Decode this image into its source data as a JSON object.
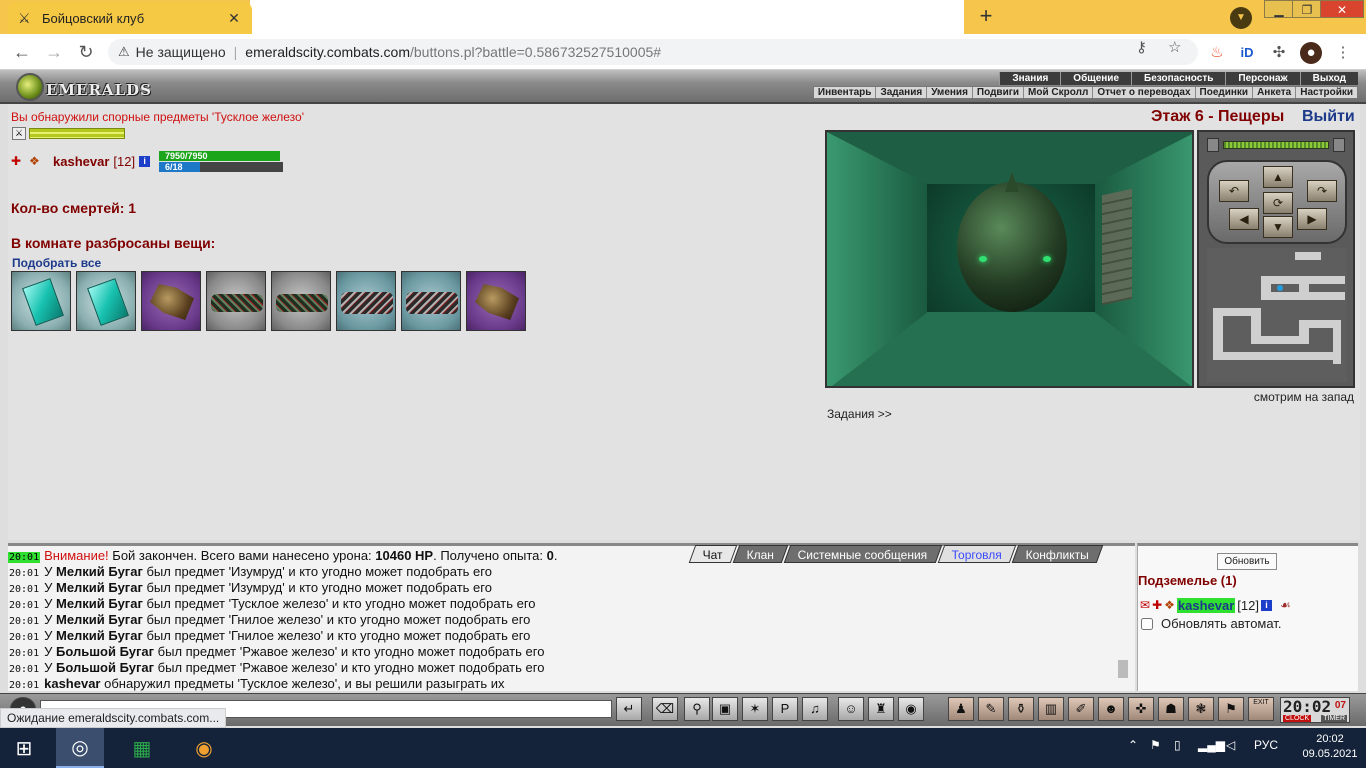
{
  "browser": {
    "tab_title": "Бойцовский клуб",
    "tab_close": "✕",
    "new_tab": "+",
    "security_label": "Не защищено",
    "url_host": "emeraldscity.combats.com",
    "url_path": "/buttons.pl?battle=0.586732527510005#",
    "status_text": "Ожидание emeraldscity.combats.com..."
  },
  "header": {
    "logo_text": "EMERALDS",
    "menu_top": [
      "Знания",
      "Общение",
      "Безопасность",
      "Персонаж",
      "Выход"
    ],
    "menu_bottom": [
      "Инвентарь",
      "Задания",
      "Умения",
      "Подвиги",
      "Мой Скролл",
      "Отчет о переводах",
      "Поединки",
      "Анкета",
      "Настройки"
    ]
  },
  "game": {
    "found_message": "Вы обнаружили спорные предметы 'Тусклое железо'",
    "player": {
      "name": "kashevar",
      "level": "[12]",
      "hp_text": "7950/7950",
      "mp_text": "6/18",
      "hp_fraction": 1.0,
      "mp_fraction": 0.333
    },
    "deaths_label": "Кол-во смертей: 1",
    "scattered_label": "В комнате разбросаны вещи:",
    "pick_all_label": "Подобрать все",
    "items": [
      "emerald",
      "emerald",
      "purple",
      "grey",
      "grey",
      "teal",
      "teal",
      "purple"
    ],
    "floor_title": "Этаж 6 - Пещеры",
    "exit_label": "Выйти",
    "looking_label": "смотрим на запад",
    "tasks_label": "Задания >>"
  },
  "chat": {
    "tabs": [
      {
        "label": "Чат",
        "state": "active"
      },
      {
        "label": "Клан",
        "state": "normal"
      },
      {
        "label": "Системные сообщения",
        "state": "normal"
      },
      {
        "label": "Торговля",
        "state": "blue"
      },
      {
        "label": "Конфликты",
        "state": "normal"
      }
    ],
    "lines": [
      {
        "time": "20:01",
        "highlight": true,
        "parts": [
          {
            "t": "Внимание!",
            "s": "red"
          },
          {
            "t": " Бой закончен. Всего вами нанесено урона: ",
            "s": ""
          },
          {
            "t": "10460 HP",
            "s": "b"
          },
          {
            "t": ". Получено опыта: ",
            "s": ""
          },
          {
            "t": "0",
            "s": "b"
          },
          {
            "t": ".",
            "s": ""
          }
        ]
      },
      {
        "time": "20:01",
        "highlight": false,
        "parts": [
          {
            "t": "У ",
            "s": ""
          },
          {
            "t": "Мелкий Бугаг",
            "s": "b"
          },
          {
            "t": " был предмет 'Изумруд' и кто угодно может подобрать его",
            "s": ""
          }
        ]
      },
      {
        "time": "20:01",
        "highlight": false,
        "parts": [
          {
            "t": "У ",
            "s": ""
          },
          {
            "t": "Мелкий Бугаг",
            "s": "b"
          },
          {
            "t": " был предмет 'Изумруд' и кто угодно может подобрать его",
            "s": ""
          }
        ]
      },
      {
        "time": "20:01",
        "highlight": false,
        "parts": [
          {
            "t": "У ",
            "s": ""
          },
          {
            "t": "Мелкий Бугаг",
            "s": "b"
          },
          {
            "t": " был предмет 'Тусклое железо' и кто угодно может подобрать его",
            "s": ""
          }
        ]
      },
      {
        "time": "20:01",
        "highlight": false,
        "parts": [
          {
            "t": "У ",
            "s": ""
          },
          {
            "t": "Мелкий Бугаг",
            "s": "b"
          },
          {
            "t": " был предмет 'Гнилое железо' и кто угодно может подобрать его",
            "s": ""
          }
        ]
      },
      {
        "time": "20:01",
        "highlight": false,
        "parts": [
          {
            "t": "У ",
            "s": ""
          },
          {
            "t": "Мелкий Бугаг",
            "s": "b"
          },
          {
            "t": " был предмет 'Гнилое железо' и кто угодно может подобрать его",
            "s": ""
          }
        ]
      },
      {
        "time": "20:01",
        "highlight": false,
        "parts": [
          {
            "t": "У ",
            "s": ""
          },
          {
            "t": "Большой Бугаг",
            "s": "b"
          },
          {
            "t": " был предмет 'Ржавое железо' и кто угодно может подобрать его",
            "s": ""
          }
        ]
      },
      {
        "time": "20:01",
        "highlight": false,
        "parts": [
          {
            "t": "У ",
            "s": ""
          },
          {
            "t": "Большой Бугаг",
            "s": "b"
          },
          {
            "t": " был предмет 'Ржавое железо' и кто угодно может подобрать его",
            "s": ""
          }
        ]
      },
      {
        "time": "20:01",
        "highlight": false,
        "parts": [
          {
            "t": "kashevar",
            "s": "b"
          },
          {
            "t": " обнаружил предметы 'Тусклое железо', и вы решили разыграть их",
            "s": ""
          }
        ]
      }
    ]
  },
  "online": {
    "refresh_label": "Обновить",
    "room_label": "Подземелье (1)",
    "user_name": "kashevar",
    "user_level": "[12]",
    "auto_refresh_label": "Обновлять автомат."
  },
  "toolbar": {
    "clock_time": "20:02",
    "clock_seconds": "07",
    "clock_label": "CLOCK",
    "timer_label": "TIMER",
    "exit_label": "EXIT"
  },
  "taskbar": {
    "lang": "РУС",
    "time": "20:02",
    "date": "09.05.2021"
  },
  "colors": {
    "tabstrip": "#f5c64b",
    "accent_red": "#800000",
    "link_blue": "#1d3a8a",
    "highlight_green": "#30e030"
  }
}
